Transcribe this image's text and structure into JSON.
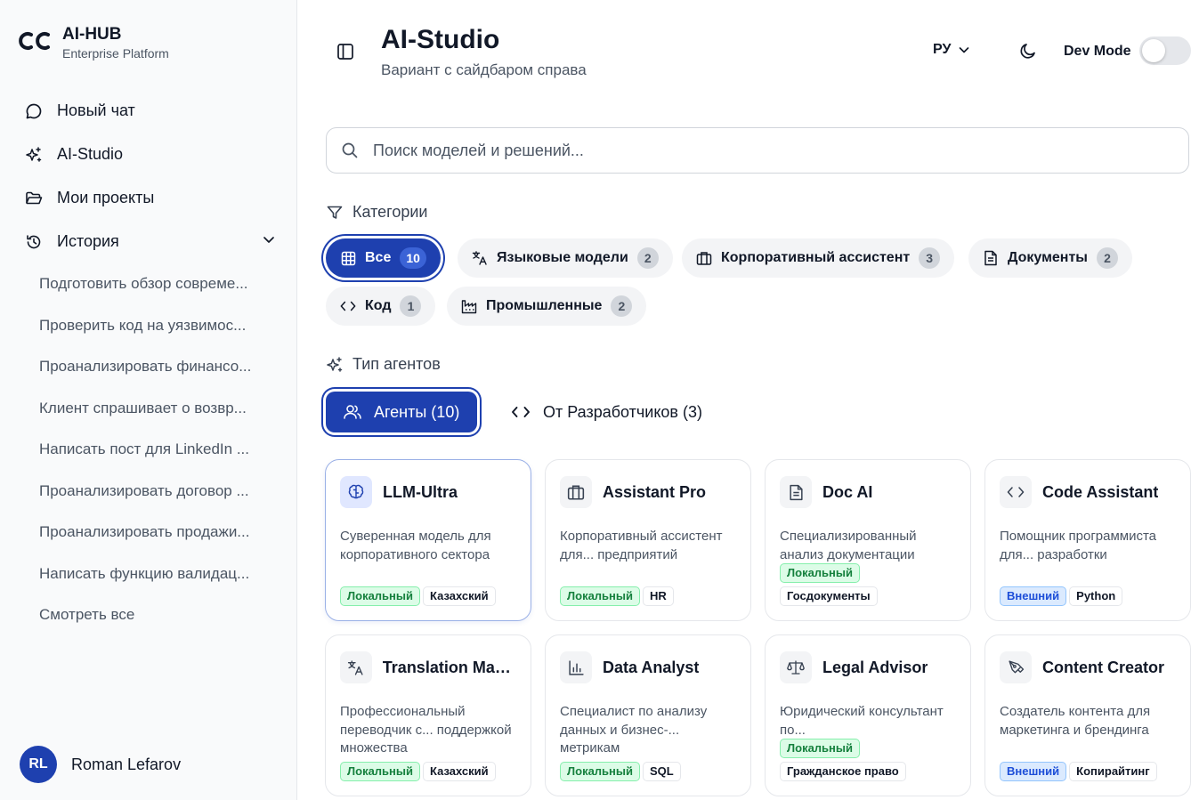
{
  "brand": {
    "name": "AI-HUB",
    "subtitle": "Enterprise Platform"
  },
  "nav": [
    {
      "label": "Новый чат",
      "icon": "chat-bubble-icon"
    },
    {
      "label": "AI-Studio",
      "icon": "sparkles-icon"
    },
    {
      "label": "Мои проекты",
      "icon": "folder-open-icon"
    },
    {
      "label": "История",
      "icon": "history-icon"
    }
  ],
  "history": [
    "Подготовить обзор совреме...",
    "Проверить код на уязвимос...",
    "Проанализировать финансо...",
    "Клиент спрашивает о возвр...",
    "Написать пост для LinkedIn ...",
    "Проанализировать договор ...",
    "Проанализировать продажи...",
    "Написать функцию валидац...",
    "Смотреть все"
  ],
  "user": {
    "initials": "RL",
    "name": "Roman Lefarov"
  },
  "header": {
    "title": "AI-Studio",
    "subtitle": "Вариант с сайдбаром справа",
    "lang": "РУ",
    "dev_mode": "Dev Mode"
  },
  "search": {
    "placeholder": "Поиск моделей и решений..."
  },
  "categories": {
    "label": "Категории",
    "items": [
      {
        "label": "Все",
        "count": "10",
        "icon": "grid-icon"
      },
      {
        "label": "Языковые модели",
        "count": "2",
        "icon": "translate-icon"
      },
      {
        "label": "Корпоративный ассистент",
        "count": "3",
        "icon": "briefcase-icon"
      },
      {
        "label": "Документы",
        "count": "2",
        "icon": "document-icon"
      },
      {
        "label": "Код",
        "count": "1",
        "icon": "code-icon"
      },
      {
        "label": "Промышленные",
        "count": "2",
        "icon": "factory-icon"
      }
    ]
  },
  "agent_type": {
    "label": "Тип агентов",
    "tabs": [
      {
        "label": "Агенты (10)",
        "icon": "users-icon"
      },
      {
        "label": "От Разработчиков (3)",
        "icon": "code-icon"
      }
    ]
  },
  "cards": [
    {
      "title": "LLM-Ultra",
      "icon": "brain-icon",
      "desc": "Суверенная модель для корпоративного сектора",
      "tags": [
        {
          "t": "Локальный",
          "k": "local"
        },
        {
          "t": "Казахский",
          "k": "plain"
        }
      ]
    },
    {
      "title": "Assistant Pro",
      "icon": "briefcase-icon",
      "desc": "Корпоративный ассистент для... предприятий",
      "tags": [
        {
          "t": "Локальный",
          "k": "local"
        },
        {
          "t": "HR",
          "k": "plain"
        }
      ]
    },
    {
      "title": "Doc AI",
      "icon": "document-icon",
      "desc": "Специализированный анализ документации",
      "tags": [
        {
          "t": "Локальный",
          "k": "local"
        },
        {
          "t": "Госдокументы",
          "k": "plain"
        }
      ]
    },
    {
      "title": "Code Assistant",
      "icon": "code-icon",
      "desc": "Помощник программиста для... разработки",
      "tags": [
        {
          "t": "Внешний",
          "k": "external"
        },
        {
          "t": "Python",
          "k": "plain"
        }
      ]
    },
    {
      "title": "Translation Mas...",
      "icon": "translate-icon",
      "desc": "Профессиональный переводчик с... поддержкой множества",
      "tags": [
        {
          "t": "Локальный",
          "k": "local"
        },
        {
          "t": "Казахский",
          "k": "plain"
        }
      ]
    },
    {
      "title": "Data Analyst",
      "icon": "bar-chart-icon",
      "desc": "Специалист по анализу данных и бизнес-... метрикам",
      "tags": [
        {
          "t": "Локальный",
          "k": "local"
        },
        {
          "t": "SQL",
          "k": "plain"
        }
      ]
    },
    {
      "title": "Legal Advisor",
      "icon": "scales-icon",
      "desc": "Юридический консультант по...",
      "tags": [
        {
          "t": "Локальный",
          "k": "local"
        },
        {
          "t": "Гражданское право",
          "k": "plain"
        }
      ]
    },
    {
      "title": "Content Creator",
      "icon": "pen-tool-icon",
      "desc": "Создатель контента для маркетинга и брендинга",
      "tags": [
        {
          "t": "Внешний",
          "k": "external"
        },
        {
          "t": "Копирайтинг",
          "k": "plain"
        }
      ]
    }
  ],
  "colors": {
    "accent": "#1e40af",
    "local": "#15803d",
    "external": "#1d4ed8"
  }
}
